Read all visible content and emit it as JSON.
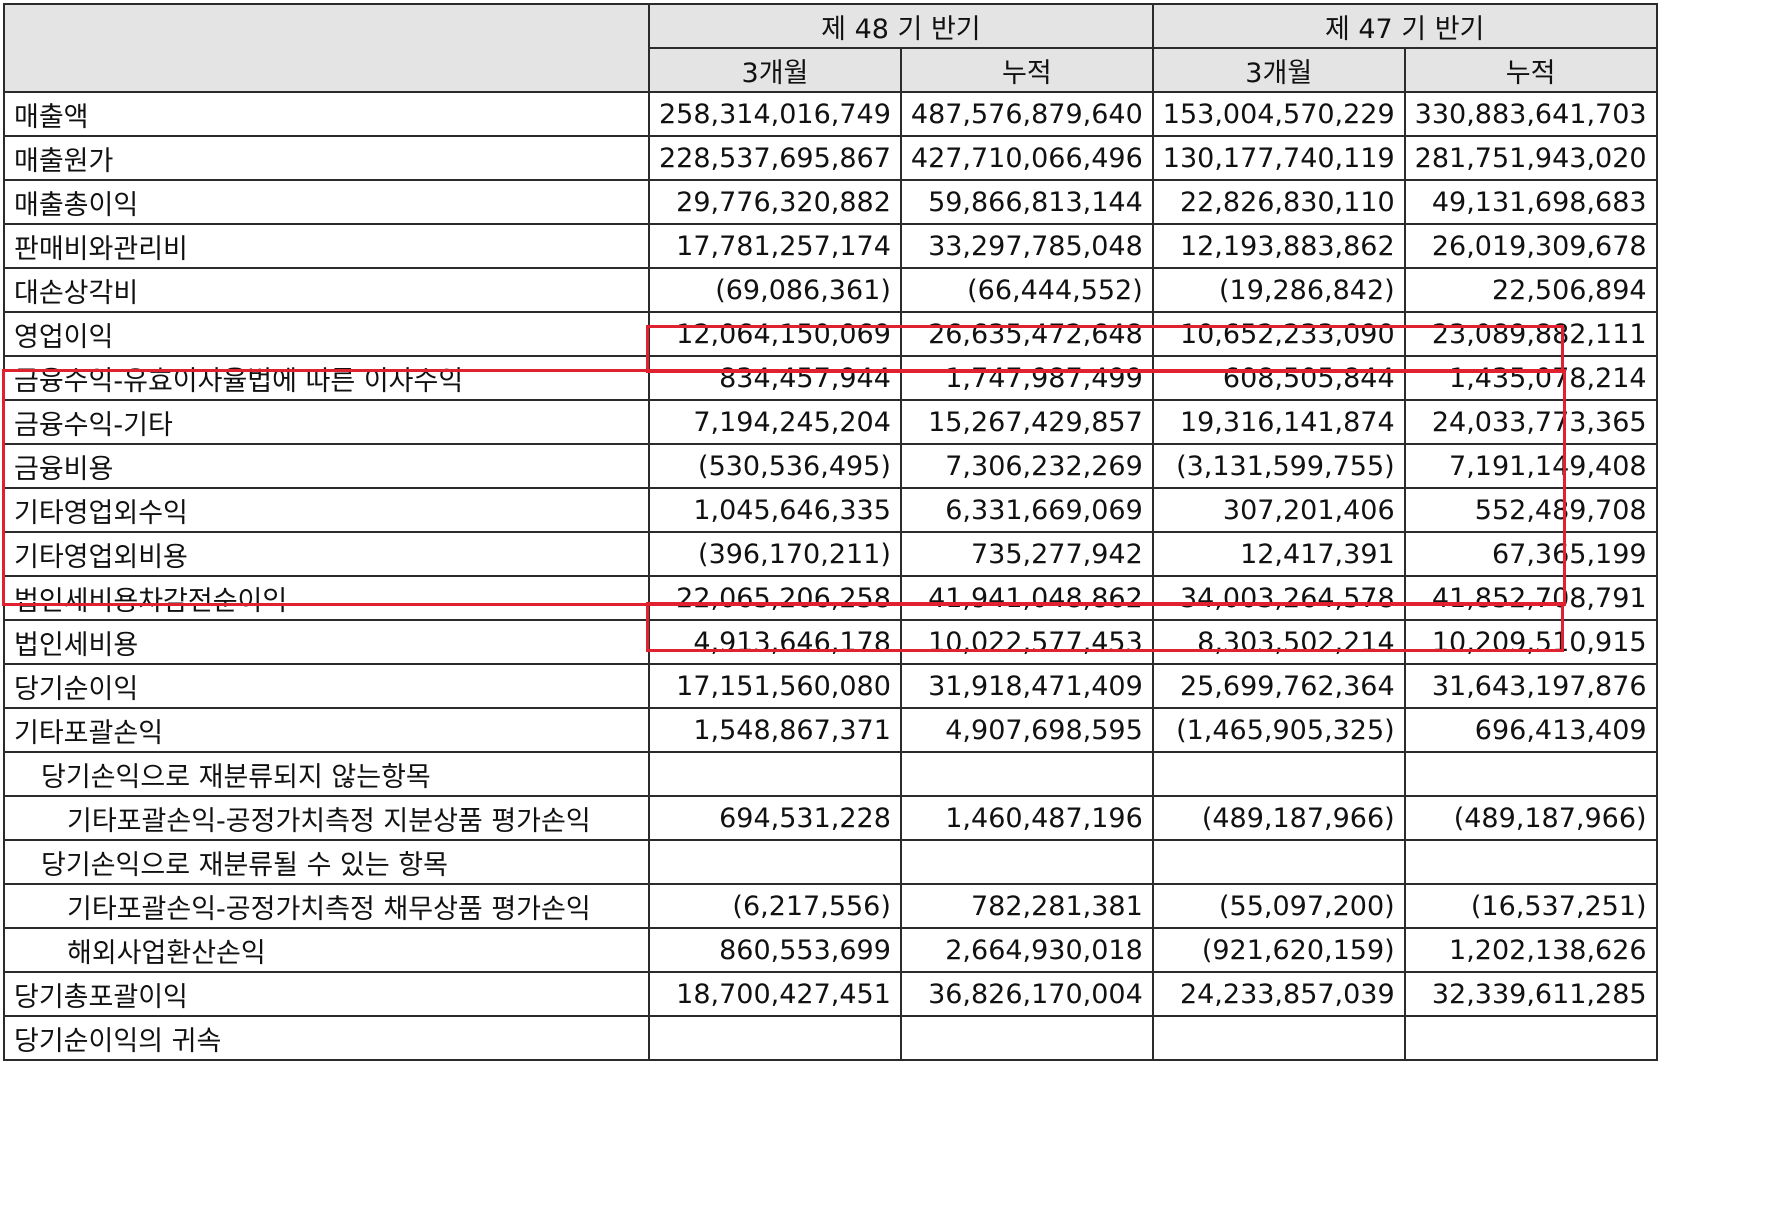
{
  "header": {
    "period_48": "제 48 기 반기",
    "period_47": "제 47 기 반기",
    "sub": [
      "3개월",
      "누적",
      "3개월",
      "누적"
    ]
  },
  "rows": [
    {
      "label": "매출액",
      "indent": 0,
      "values": [
        "258,314,016,749",
        "487,576,879,640",
        "153,004,570,229",
        "330,883,641,703"
      ]
    },
    {
      "label": "매출원가",
      "indent": 0,
      "values": [
        "228,537,695,867",
        "427,710,066,496",
        "130,177,740,119",
        "281,751,943,020"
      ]
    },
    {
      "label": "매출총이익",
      "indent": 0,
      "values": [
        "29,776,320,882",
        "59,866,813,144",
        "22,826,830,110",
        "49,131,698,683"
      ]
    },
    {
      "label": "판매비와관리비",
      "indent": 0,
      "values": [
        "17,781,257,174",
        "33,297,785,048",
        "12,193,883,862",
        "26,019,309,678"
      ]
    },
    {
      "label": "대손상각비",
      "indent": 0,
      "values": [
        "(69,086,361)",
        "(66,444,552)",
        "(19,286,842)",
        "22,506,894"
      ]
    },
    {
      "label": "영업이익",
      "indent": 0,
      "values": [
        "12,064,150,069",
        "26,635,472,648",
        "10,652,233,090",
        "23,089,882,111"
      ]
    },
    {
      "label": "금융수익-유효이자율법에 따른 이자수익",
      "indent": 0,
      "values": [
        "834,457,944",
        "1,747,987,499",
        "608,505,844",
        "1,435,078,214"
      ]
    },
    {
      "label": "금융수익-기타",
      "indent": 0,
      "values": [
        "7,194,245,204",
        "15,267,429,857",
        "19,316,141,874",
        "24,033,773,365"
      ]
    },
    {
      "label": "금융비용",
      "indent": 0,
      "values": [
        "(530,536,495)",
        "7,306,232,269",
        "(3,131,599,755)",
        "7,191,149,408"
      ]
    },
    {
      "label": "기타영업외수익",
      "indent": 0,
      "values": [
        "1,045,646,335",
        "6,331,669,069",
        "307,201,406",
        "552,489,708"
      ]
    },
    {
      "label": "기타영업외비용",
      "indent": 0,
      "values": [
        "(396,170,211)",
        "735,277,942",
        "12,417,391",
        "67,365,199"
      ]
    },
    {
      "label": "법인세비용차감전순이익",
      "indent": 0,
      "values": [
        "22,065,206,258",
        "41,941,048,862",
        "34,003,264,578",
        "41,852,708,791"
      ]
    },
    {
      "label": "법인세비용",
      "indent": 0,
      "values": [
        "4,913,646,178",
        "10,022,577,453",
        "8,303,502,214",
        "10,209,510,915"
      ]
    },
    {
      "label": "당기순이익",
      "indent": 0,
      "values": [
        "17,151,560,080",
        "31,918,471,409",
        "25,699,762,364",
        "31,643,197,876"
      ]
    },
    {
      "label": "기타포괄손익",
      "indent": 0,
      "values": [
        "1,548,867,371",
        "4,907,698,595",
        "(1,465,905,325)",
        "696,413,409"
      ]
    },
    {
      "label": "당기손익으로 재분류되지 않는항목",
      "indent": 1,
      "values": [
        "",
        "",
        "",
        ""
      ]
    },
    {
      "label": "기타포괄손익-공정가치측정 지분상품 평가손익",
      "indent": 2,
      "values": [
        "694,531,228",
        "1,460,487,196",
        "(489,187,966)",
        "(489,187,966)"
      ]
    },
    {
      "label": "당기손익으로 재분류될 수 있는 항목",
      "indent": 1,
      "values": [
        "",
        "",
        "",
        ""
      ]
    },
    {
      "label": "기타포괄손익-공정가치측정 채무상품 평가손익",
      "indent": 2,
      "values": [
        "(6,217,556)",
        "782,281,381",
        "(55,097,200)",
        "(16,537,251)"
      ]
    },
    {
      "label": "해외사업환산손익",
      "indent": 2,
      "values": [
        "860,553,699",
        "2,664,930,018",
        "(921,620,159)",
        "1,202,138,626"
      ]
    },
    {
      "label": "당기총포괄이익",
      "indent": 0,
      "values": [
        "18,700,427,451",
        "36,826,170,004",
        "24,233,857,039",
        "32,339,611,285"
      ]
    },
    {
      "label": "당기순이익의 귀속",
      "indent": 0,
      "values": [
        "",
        "",
        "",
        ""
      ]
    }
  ],
  "colors": {
    "highlight": "#e0212f",
    "header_bg": "#e4e4e4"
  }
}
